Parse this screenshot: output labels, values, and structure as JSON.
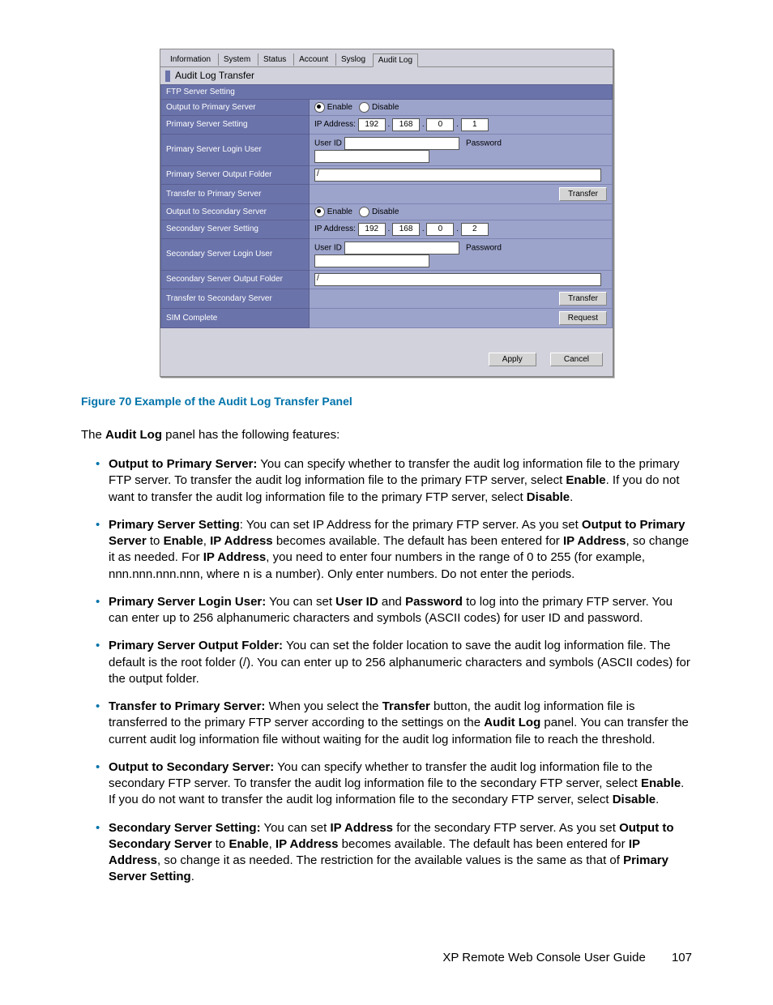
{
  "tabs": [
    "Information",
    "System",
    "Status",
    "Account",
    "Syslog",
    "Audit Log"
  ],
  "subheader": "Audit Log Transfer",
  "section_header": "FTP Server Setting",
  "rows": {
    "out_primary": "Output to Primary Server",
    "prim_setting": "Primary Server Setting",
    "prim_login": "Primary Server Login User",
    "prim_folder": "Primary Server Output Folder",
    "xfer_prim": "Transfer to Primary Server",
    "out_secondary": "Output to Secondary Server",
    "sec_setting": "Secondary Server Setting",
    "sec_login": "Secondary Server Login User",
    "sec_folder": "Secondary Server Output Folder",
    "xfer_sec": "Transfer to Secondary Server",
    "sim": "SIM Complete"
  },
  "labels": {
    "enable": "Enable",
    "disable": "Disable",
    "ip": "IP Address:",
    "userid": "User ID",
    "password": "Password",
    "transfer": "Transfer",
    "request": "Request",
    "apply": "Apply",
    "cancel": "Cancel"
  },
  "ip1": [
    "192",
    "168",
    "0",
    "1"
  ],
  "ip2": [
    "192",
    "168",
    "0",
    "2"
  ],
  "folder_default": "/",
  "caption": "Figure 70 Example of the Audit Log Transfer Panel",
  "intro_pre": "The ",
  "intro_bold": "Audit Log",
  "intro_post": " panel has the following features:",
  "b1": {
    "t": "Output to Primary Server:",
    "a": " You can specify whether to transfer the audit log information file to the primary FTP server. To transfer the audit log information file to the primary FTP server, select ",
    "b": "Enable",
    "c": ". If you do not want to transfer the audit log information file to the primary FTP server, select ",
    "d": "Disable",
    "e": "."
  },
  "b2": {
    "t": "Primary Server Setting",
    "a": ": You can set IP Address for the primary FTP server. As you set ",
    "b": "Output to Primary Server",
    "c": " to ",
    "d": "Enable",
    "e": ", ",
    "f": "IP Address",
    "g": " becomes available. The default has been entered for ",
    "h": "IP Address",
    "i": ", so change it as needed. For ",
    "j": "IP Address",
    "k": ", you need to enter four numbers in the range of 0 to 255 (for example, nnn.nnn.nnn.nnn, where n is a number). Only enter numbers. Do not enter the periods."
  },
  "b3": {
    "t": "Primary Server Login User:",
    "a": " You can set ",
    "b": "User ID",
    "c": " and ",
    "d": "Password",
    "e": " to log into the primary FTP server. You can enter up to 256 alphanumeric characters and symbols (ASCII codes) for user ID and password."
  },
  "b4": {
    "t": "Primary Server Output Folder:",
    "a": " You can set the folder location to save the audit log information file. The default is the root folder (/). You can enter up to 256 alphanumeric characters and symbols (ASCII codes) for the output folder."
  },
  "b5": {
    "t": "Transfer to Primary Server:",
    "a": " When you select the ",
    "b": "Transfer",
    "c": " button, the audit log information file is transferred to the primary FTP server according to the settings on the ",
    "d": "Audit Log",
    "e": " panel. You can transfer the current audit log information file without waiting for the audit log information file to reach the threshold."
  },
  "b6": {
    "t": "Output to Secondary Server:",
    "a": " You can specify whether to transfer the audit log information file to the secondary FTP server. To transfer the audit log information file to the secondary FTP server, select ",
    "b": "Enable",
    "c": ". If you do not want to transfer the audit log information file to the secondary FTP server, select ",
    "d": "Disable",
    "e": "."
  },
  "b7": {
    "t": "Secondary Server Setting:",
    "a": " You can set ",
    "b": "IP Address",
    "c": " for the secondary FTP server. As you set ",
    "d": "Output to Secondary Server",
    "e": " to ",
    "f": "Enable",
    "g": ", ",
    "h": "IP Address",
    "i": " becomes available. The default has been entered for ",
    "j": "IP Address",
    "k": ", so change it as needed. The restriction for the available values is the same as that of ",
    "l": "Primary Server Setting",
    "m": "."
  },
  "footer_title": "XP Remote Web Console User Guide",
  "footer_page": "107"
}
